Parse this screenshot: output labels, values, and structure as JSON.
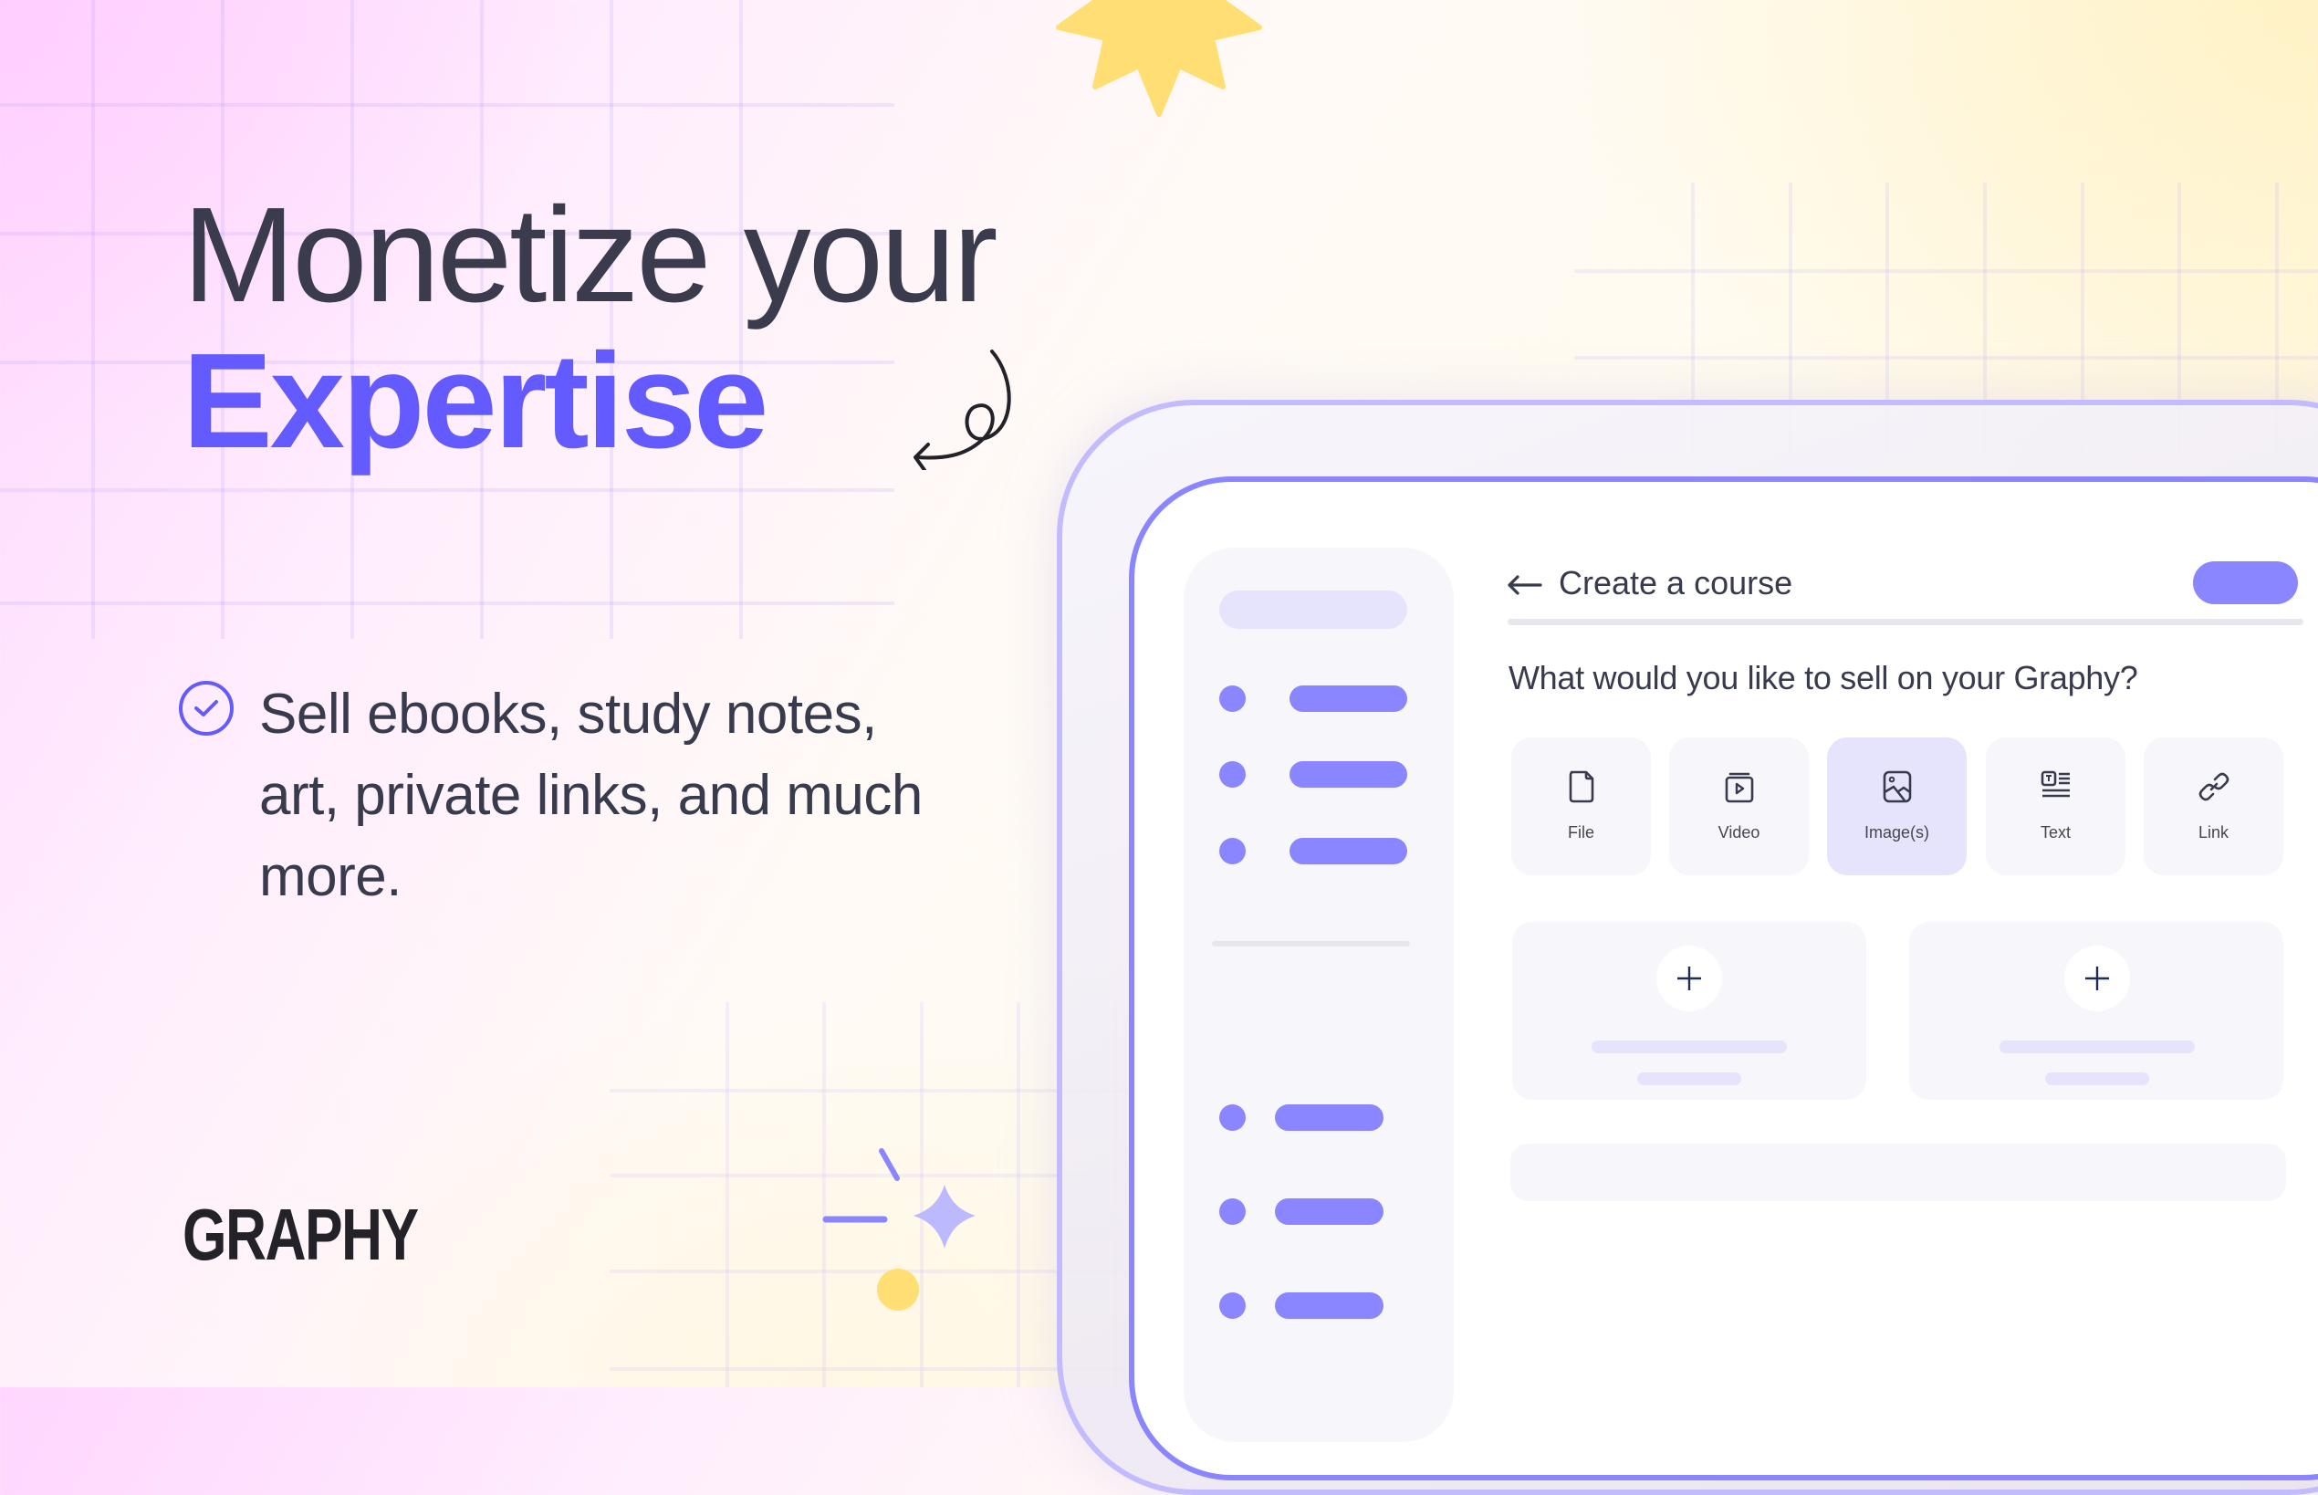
{
  "hero": {
    "headline_line1": "Monetize your",
    "headline_accent": "Expertise",
    "feature_icon": "check-circle-icon",
    "feature_text": "Sell ebooks, study notes, art, private links, and much more."
  },
  "brand": {
    "logo": "GRAPHY"
  },
  "colors": {
    "accent": "#635bff",
    "ui_accent": "#8a86ff",
    "text_dark": "#383a4d",
    "star_yellow": "#ffdf73",
    "selected_card": "#e6e3fc"
  },
  "decorations": [
    "star-burst-icon",
    "curly-arrow-icon",
    "sparkle-icon",
    "yellow-dot"
  ],
  "app": {
    "header": {
      "back_icon": "arrow-left-icon",
      "title": "Create a course"
    },
    "question": "What would you like to sell on your Graphy?",
    "content_types": [
      {
        "label": "File",
        "icon": "file-icon",
        "selected": false
      },
      {
        "label": "Video",
        "icon": "video-icon",
        "selected": false
      },
      {
        "label": "Image(s)",
        "icon": "image-icon",
        "selected": true
      },
      {
        "label": "Text",
        "icon": "text-icon",
        "selected": false
      },
      {
        "label": "Link",
        "icon": "link-icon",
        "selected": false
      }
    ],
    "add_cards": [
      {
        "icon": "plus-icon"
      },
      {
        "icon": "plus-icon"
      }
    ],
    "sidebar": {
      "top_items": 3,
      "bottom_items": 3
    }
  }
}
